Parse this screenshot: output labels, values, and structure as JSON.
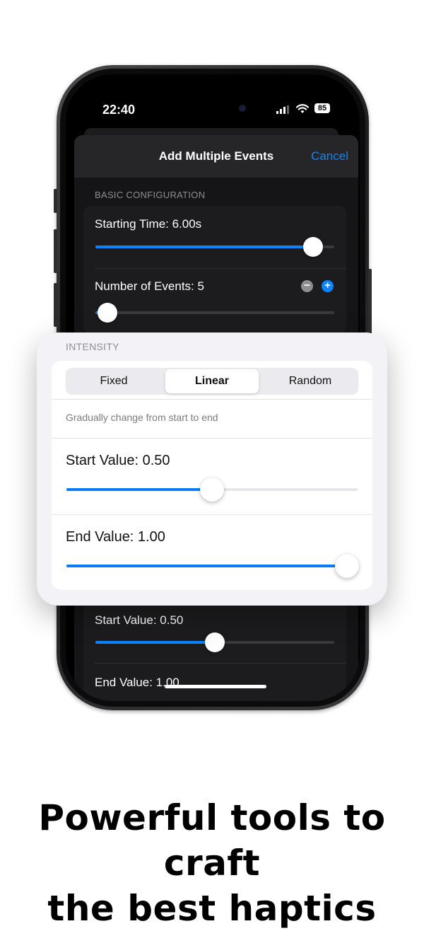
{
  "status_bar": {
    "time": "22:40",
    "battery": "85"
  },
  "sheet": {
    "title": "Add Multiple Events",
    "cancel_label": "Cancel",
    "basic_header": "BASIC CONFIGURATION",
    "starting_time_label": "Starting Time: 6.00s",
    "starting_time_fraction": 0.91,
    "events_label": "Number of Events: 5",
    "events_fraction": 0.05,
    "start_value_label": "Start Value: 0.50",
    "start_value_fraction": 0.5,
    "end_value_label": "End Value: 1.00"
  },
  "intensity_card": {
    "header": "INTENSITY",
    "segments": [
      "Fixed",
      "Linear",
      "Random"
    ],
    "selected_segment": "Linear",
    "hint": "Gradually change from start to end",
    "start_value_label": "Start Value: 0.50",
    "start_value": 0.5,
    "end_value_label": "End Value: 1.00",
    "end_value": 1.0
  },
  "caption": {
    "line1": "Powerful tools to craft",
    "line2": "the best haptics"
  },
  "colors": {
    "accent": "#0a84ff",
    "dark_bg": "#151517",
    "card_bg": "#f2f2f7"
  }
}
